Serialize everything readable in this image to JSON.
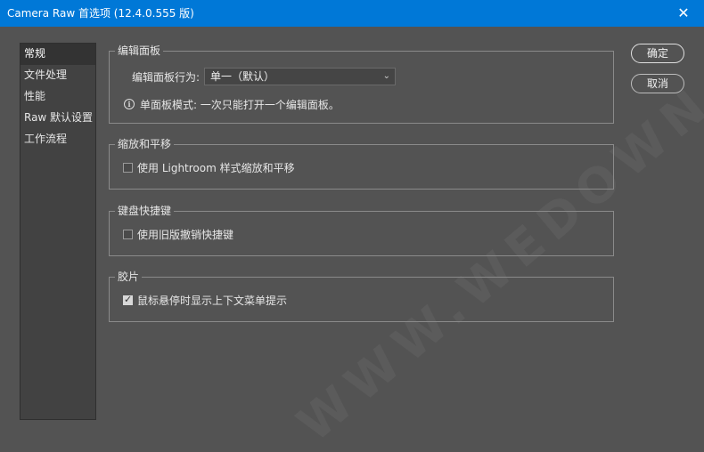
{
  "window": {
    "title": "Camera Raw 首选项 (12.4.0.555 版)",
    "close_icon": "close-icon"
  },
  "sidebar": {
    "items": [
      {
        "label": "常规",
        "selected": true
      },
      {
        "label": "文件处理",
        "selected": false
      },
      {
        "label": "性能",
        "selected": false
      },
      {
        "label": "Raw 默认设置",
        "selected": false
      },
      {
        "label": "工作流程",
        "selected": false
      }
    ]
  },
  "groups": {
    "editing_panel": {
      "legend": "编辑面板",
      "behavior_label": "编辑面板行为:",
      "behavior_value": "单一（默认）",
      "info_text": "单面板模式: 一次只能打开一个编辑面板。"
    },
    "zoom_pan": {
      "legend": "缩放和平移",
      "checkbox_label": "使用 Lightroom 样式缩放和平移",
      "checked": false
    },
    "keyboard_shortcuts": {
      "legend": "键盘快捷键",
      "checkbox_label": "使用旧版撤销快捷键",
      "checked": false
    },
    "filmstrip": {
      "legend": "胶片",
      "checkbox_label": "鼠标悬停时显示上下文菜单提示",
      "checked": true
    }
  },
  "buttons": {
    "ok": "确定",
    "cancel": "取消"
  },
  "watermark": "WWW.WEDOWN.COM",
  "colors": {
    "titlebar": "#0078d7",
    "background": "#535353",
    "sidebar": "#424242"
  }
}
